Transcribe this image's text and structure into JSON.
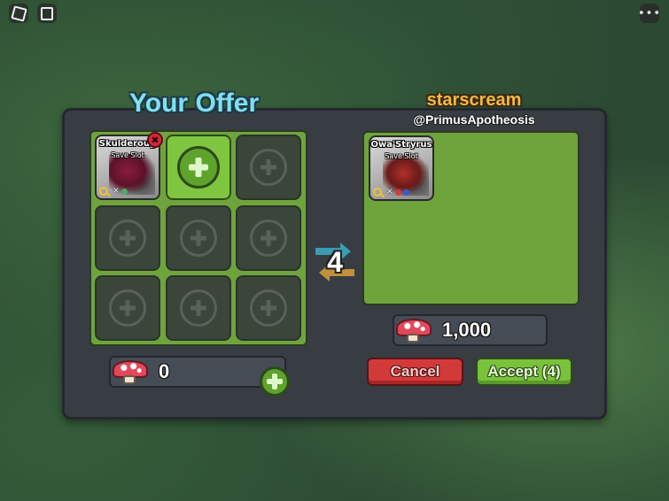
{
  "window": {
    "menu_icon": "roblox-logo-icon",
    "chat_icon": "chat-icon",
    "more_icon": "more-options-icon",
    "more_glyph": "•••"
  },
  "your_offer": {
    "title": "Your Offer",
    "slots": [
      {
        "type": "creature",
        "name": "Skulderoug",
        "subtitle": "Save Slot"
      },
      {
        "type": "add"
      },
      {
        "type": "empty"
      },
      {
        "type": "empty"
      },
      {
        "type": "empty"
      },
      {
        "type": "empty"
      },
      {
        "type": "empty"
      },
      {
        "type": "empty"
      },
      {
        "type": "empty"
      }
    ],
    "remove_glyph": "✖",
    "currency_amount": "0"
  },
  "trade": {
    "count": "4"
  },
  "their_offer": {
    "display_name": "starscream",
    "username": "@PrimusApotheosis",
    "slots": [
      {
        "type": "creature",
        "name": "Owa'Stryrus",
        "subtitle": "Save Slot"
      }
    ],
    "currency_amount": "1,000"
  },
  "card_icons": {
    "gene_glyph": "✕"
  },
  "actions": {
    "cancel_label": "Cancel",
    "accept_label": "Accept (4)"
  },
  "colors": {
    "panel_green": "#6fa43d",
    "accent_title": "#7fe0f2",
    "username_orange": "#f5b742",
    "cancel_red": "#d23a3a",
    "accept_green": "#79c23a"
  }
}
